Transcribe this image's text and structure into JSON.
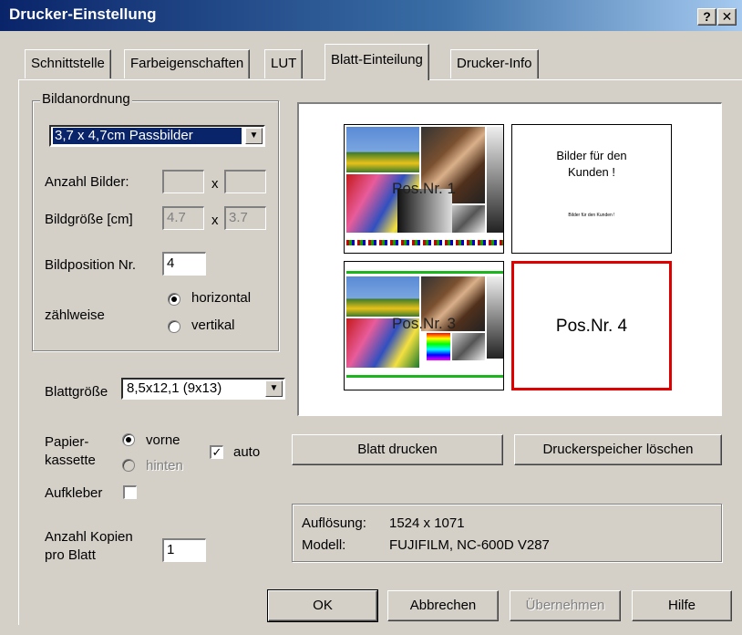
{
  "window": {
    "title": "Drucker-Einstellung",
    "help_label": "?",
    "close_label": "✕"
  },
  "tabs": [
    {
      "label": "Schnittstelle",
      "active": false
    },
    {
      "label": "Farbeigenschaften",
      "active": false
    },
    {
      "label": "LUT",
      "active": false
    },
    {
      "label": "Blatt-Einteilung",
      "active": true
    },
    {
      "label": "Drucker-Info",
      "active": false
    }
  ],
  "bildanordnung": {
    "legend": "Bildanordnung",
    "layout_select": "3,7 x 4,7cm Passbilder",
    "anzahl_label": "Anzahl Bilder:",
    "anzahl_x": "",
    "anzahl_y": "",
    "times": "x",
    "bildgroesse_label": "Bildgröße [cm]",
    "bildgroesse_w": "4.7",
    "bildgroesse_h": "3.7",
    "bildposition_label": "Bildposition Nr.",
    "bildposition_value": "4",
    "zaehlweise_label": "zählweise",
    "radio_horizontal": "horizontal",
    "radio_vertikal": "vertikal",
    "selected_order": "horizontal"
  },
  "blattgroesse": {
    "label": "Blattgröße",
    "value": "8,5x12,1 (9x13)"
  },
  "papierkassette": {
    "label_line1": "Papier-",
    "label_line2": "kassette",
    "vorne": "vorne",
    "hinten": "hinten",
    "auto_label": "auto",
    "auto_checked": true
  },
  "aufkleber": {
    "label": "Aufkleber",
    "checked": false
  },
  "kopien": {
    "label_line1": "Anzahl Kopien",
    "label_line2": "pro Blatt",
    "value": "1"
  },
  "preview": {
    "slot1_label": "Pos.Nr. 1",
    "slot2_line1": "Bilder für den",
    "slot2_line2": "Kunden !",
    "slot2_small": "Bilder für den Kunden !",
    "slot3_label": "Pos.Nr. 3",
    "slot4_label": "Pos.Nr. 4",
    "highlight_color": "#e00000"
  },
  "actions": {
    "print_label": "Blatt drucken",
    "clear_memory_label": "Druckerspeicher löschen"
  },
  "info": {
    "aufloesung_label": "Auflösung:",
    "aufloesung_value": "1524 x 1071",
    "modell_label": "Modell:",
    "modell_value": "FUJIFILM, NC-600D V287"
  },
  "footer": {
    "ok": "OK",
    "cancel": "Abbrechen",
    "apply": "Übernehmen",
    "help": "Hilfe"
  }
}
